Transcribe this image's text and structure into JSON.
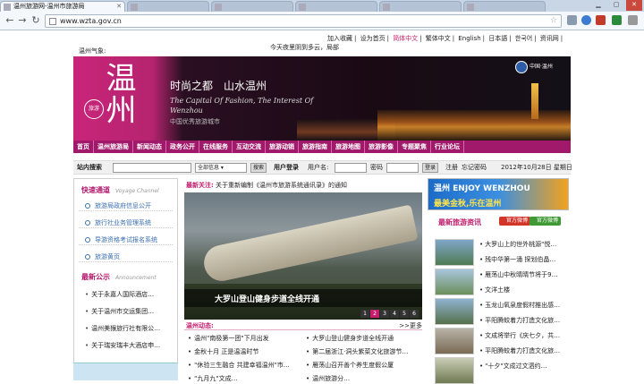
{
  "browser": {
    "active_tab": "温州旅游网-温州市旅游局",
    "bg_tabs": [
      "",
      "",
      "",
      "",
      ""
    ],
    "url": "www.wzta.gov.cn"
  },
  "topnav": [
    "加入收藏",
    "设为首页",
    "简体中文",
    "繁体中文",
    "English",
    "日本語",
    "한국어",
    "资讯网"
  ],
  "weather_label": "温州气象:",
  "city_line": "今天夜里阴到多云，局部",
  "banner": {
    "logo_char": "温州",
    "stamp": "旅游",
    "slogan": "时尚之都　山水温州",
    "en": "The Capital Of Fashion, The Interest Of Wenzhou",
    "cn": "中国优秀旅游城市",
    "emblem": "中国·温州"
  },
  "mainnav": [
    "首页",
    "温州旅游局",
    "新闻动态",
    "政务公开",
    "在线服务",
    "互动交流",
    "旅游动销",
    "旅游指南",
    "旅游地图",
    "旅游影像",
    "专题聚焦",
    "行业论坛"
  ],
  "searchbar": {
    "label": "站内搜索",
    "select": "全部信息",
    "search_btn": "搜索",
    "login_label": "用户登录",
    "user_label": "用户名:",
    "pwd_label": "密码",
    "login_btn": "登录",
    "register": "注册",
    "forgot": "忘记密码",
    "date": "2012年10月28日 星期日"
  },
  "left": {
    "quick_title": "快速通道",
    "quick_en": "Voyage Channel",
    "quick_items": [
      "旅游局政府信息公开",
      "旅行社业务管理系统",
      "导游资格考试报名系统",
      "旅游黄页"
    ],
    "notice_title": "最新公示",
    "notice_en": "Announcement",
    "notices": [
      "关于永嘉人国际酒店…",
      "关于温州市交运集团…",
      "温州美猴旅行社有限公…",
      "关于瑞安瑞丰大酒店申…"
    ]
  },
  "mid": {
    "newest_label": "最新关注:",
    "newest_text": "关于重新编制《温州市旅游系统通讯录》的通知",
    "photo_caption": "大罗山登山健身步道全线开通",
    "pager": [
      "1",
      "2",
      "3",
      "4",
      "5",
      "6"
    ],
    "news_title": "温州动态:",
    "more": ">>更多",
    "news_left": [
      "温州\"南极第一团\"下月出发",
      "金秋十月 正是温温时节",
      "\"休验三生融合 共建幸福温州\"市…",
      "\"九月九\"文成…"
    ],
    "news_right": [
      "大罗山登山健身步道全线开通",
      "第二届浙江·洞头紫菜文化旅游节…",
      "雁荡山召开善个养生度假公厦",
      "温州旅游分…"
    ]
  },
  "right": {
    "banner_l1": "温州 ENJOY WENZHOU",
    "banner_l2": "最美金秋,乐在温州",
    "info_title": "最新旅游资讯",
    "tag1": "官方微博",
    "tag2": "官方微博",
    "items": [
      "大罗山上的世外桃源\"悦…",
      "残中华第一涌 探划伯晶…",
      "雁荡山中秋晴晴节将于9…",
      "文洋土楼",
      "玉龙山氧泉度假村推出感…",
      "平阳腾蛟着力打造文化旅…",
      "文成将举行《庆七夕，共…",
      "平阳腾蛟着力打造文化旅…",
      "\"十夕\"文成过文泗约…"
    ]
  },
  "colors": {
    "brand": "#a1196a",
    "accent": "#c41d6e",
    "link": "#3a6fb0"
  }
}
